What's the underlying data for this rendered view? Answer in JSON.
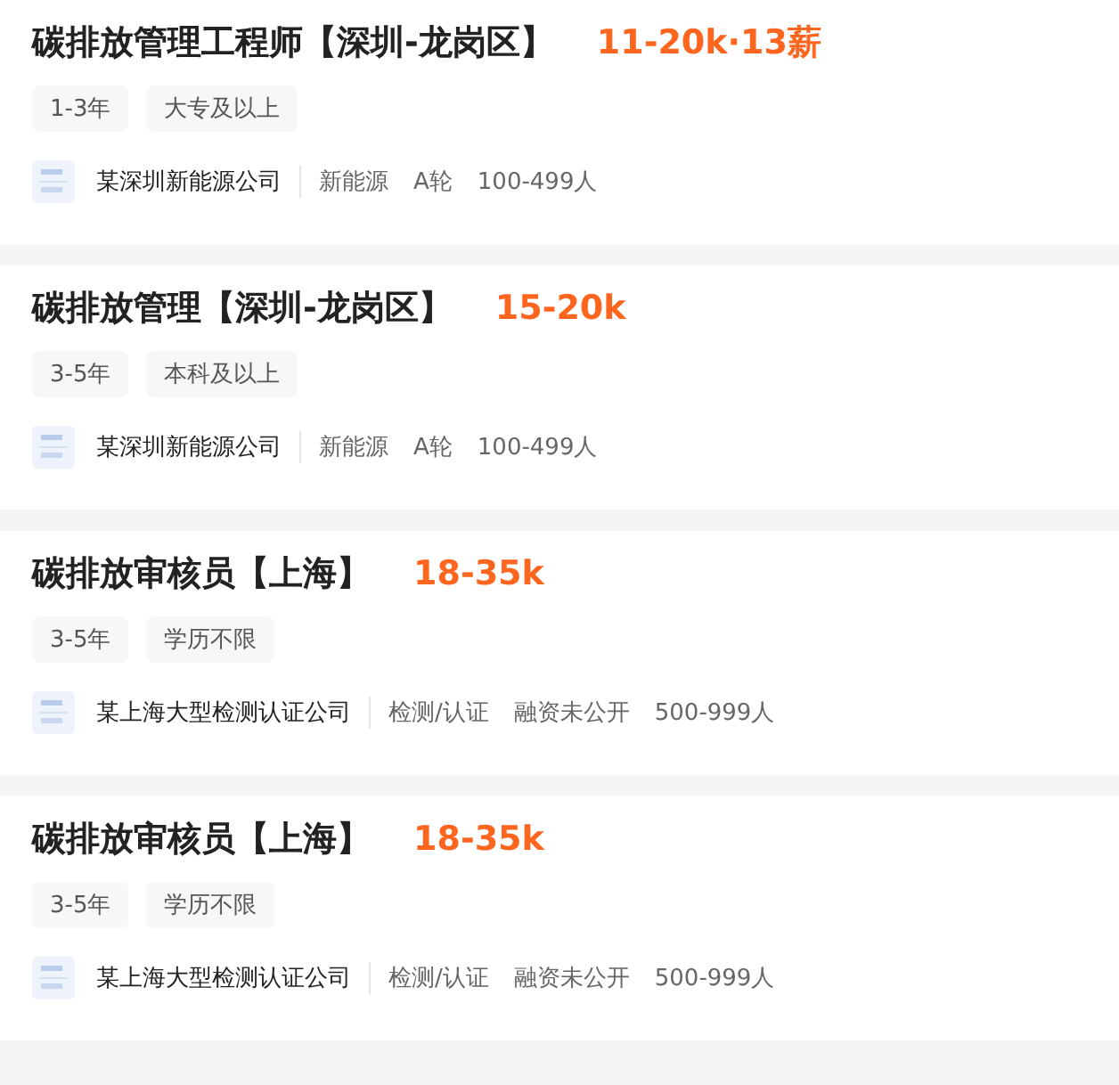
{
  "jobs": [
    {
      "title": "碳排放管理工程师【深圳-龙岗区】",
      "salary": "11-20k·13薪",
      "tags": [
        "1-3年",
        "大专及以上"
      ],
      "company": "某深圳新能源公司",
      "company_info": [
        "新能源",
        "A轮",
        "100-499人"
      ]
    },
    {
      "title": "碳排放管理【深圳-龙岗区】",
      "salary": "15-20k",
      "tags": [
        "3-5年",
        "本科及以上"
      ],
      "company": "某深圳新能源公司",
      "company_info": [
        "新能源",
        "A轮",
        "100-499人"
      ]
    },
    {
      "title": "碳排放审核员【上海】",
      "salary": "18-35k",
      "tags": [
        "3-5年",
        "学历不限"
      ],
      "company": "某上海大型检测认证公司",
      "company_info": [
        "检测/认证",
        "融资未公开",
        "500-999人"
      ]
    },
    {
      "title": "碳排放审核员【上海】",
      "salary": "18-35k",
      "tags": [
        "3-5年",
        "学历不限"
      ],
      "company": "某上海大型检测认证公司",
      "company_info": [
        "检测/认证",
        "融资未公开",
        "500-999人"
      ]
    }
  ]
}
